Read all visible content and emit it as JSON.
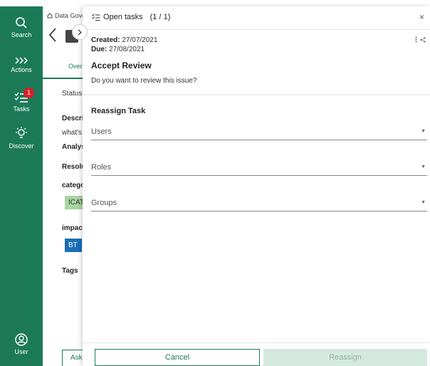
{
  "rail": {
    "search_label": "Search",
    "actions_label": "Actions",
    "tasks_label": "Tasks",
    "tasks_badge": "1",
    "discover_label": "Discover",
    "user_label": "User"
  },
  "background": {
    "breadcrumb": "Data Gove",
    "tab_label": "Over",
    "status": "Status",
    "description": "Descri",
    "description_value": "what's",
    "analysis": "Analys",
    "resolution": "Resolu",
    "category": "catego",
    "category_chip": "ICAT",
    "impact": "impac",
    "impact_chip": "BT",
    "tags": "Tags",
    "ask_button": "Ask"
  },
  "panel": {
    "title": "Open tasks",
    "count": "(1 / 1)",
    "close": "×",
    "created_label": "Created:",
    "created_value": "27/07/2021",
    "due_label": "Due:",
    "due_value": "27/08/2021",
    "task_name": "Accept Review",
    "task_description": "Do you want to review this issue?",
    "reassign_title": "Reassign Task",
    "fields": {
      "users": "Users",
      "roles": "Roles",
      "groups": "Groups"
    },
    "cancel_label": "Cancel",
    "reassign_label": "Reassign"
  },
  "colors": {
    "accent": "#1c7a58",
    "badge": "#d91f26",
    "reassign_disabled_bg": "#d4e9dd",
    "category_chip_bg": "#a8d5a0",
    "impact_chip_bg": "#1b6fb8"
  }
}
